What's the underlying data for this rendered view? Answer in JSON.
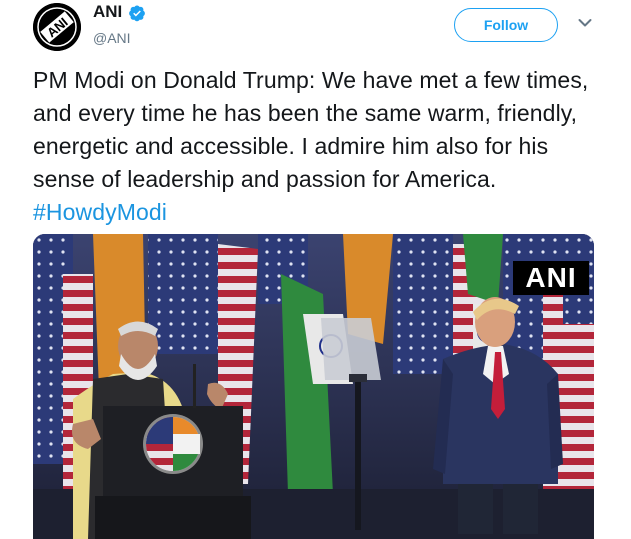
{
  "account": {
    "name": "ANI",
    "handle": "@ANI",
    "avatar_icon": "ani-logo-icon",
    "verified_icon": "verified-badge-icon",
    "avatar_text": "ANI"
  },
  "actions": {
    "follow_label": "Follow",
    "menu_icon": "chevron-down-icon"
  },
  "tweet": {
    "text": "PM Modi on Donald Trump: We have met a few times, and every time he has been the same warm, friendly, energetic and accessible. I admire him also for his sense of leadership and passion for America. ",
    "hashtag": "#HowdyModi"
  },
  "media": {
    "watermark": "ANI",
    "type": "photo"
  },
  "colors": {
    "accent": "#1da1f2",
    "hashtag": "#1b95e0",
    "text": "#14171a",
    "secondary": "#657786"
  }
}
